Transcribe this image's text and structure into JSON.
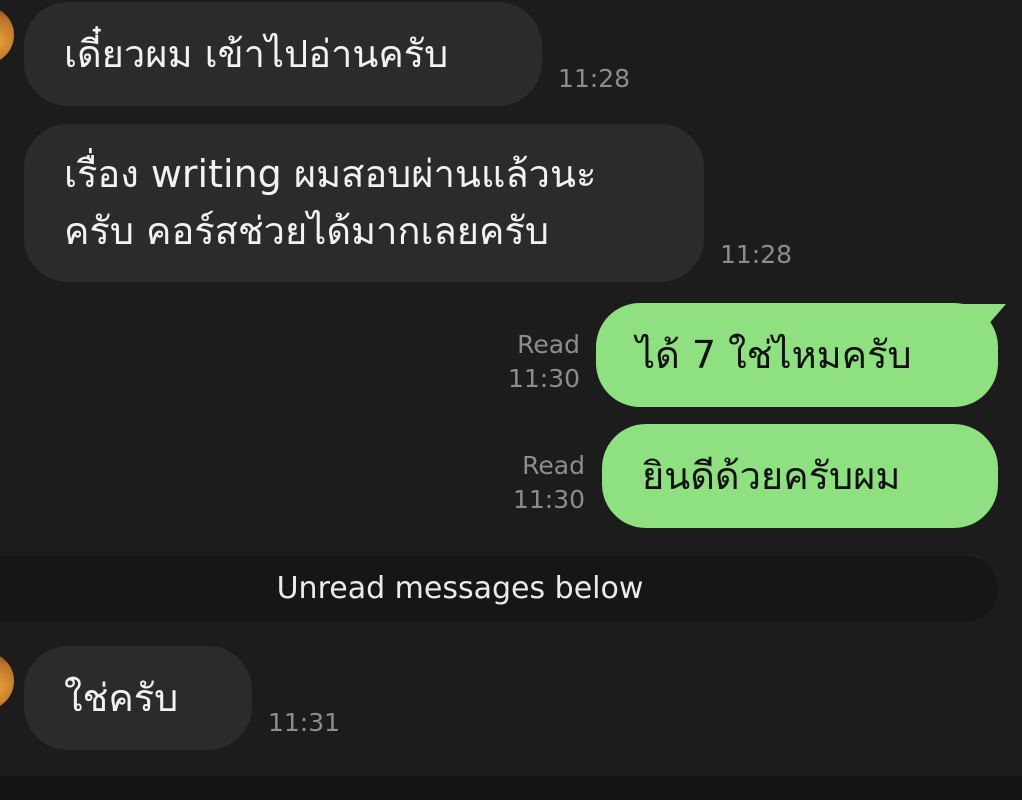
{
  "messages": [
    {
      "direction": "in",
      "text": "เดี๋ยวผม เข้าไปอ่านครับ",
      "time": "11:28"
    },
    {
      "direction": "in",
      "lines": [
        "เรื่อง writing ผมสอบผ่านแล้วนะ",
        "ครับ คอร์สช่วยได้มากเลยครับ"
      ],
      "time": "11:28"
    },
    {
      "direction": "out",
      "text": "ได้ 7 ใช่ไหมครับ",
      "status": "Read",
      "time": "11:30"
    },
    {
      "direction": "out",
      "text": "ยินดีด้วยครับผม",
      "status": "Read",
      "time": "11:30"
    },
    {
      "direction": "in",
      "text": "ใช่ครับ",
      "time": "11:31"
    }
  ],
  "divider": {
    "label": "Unread messages below"
  },
  "colors": {
    "background": "#1c1c1c",
    "incoming_bubble": "#2b2b2b",
    "outgoing_bubble": "#8ee080",
    "meta_text": "#8d8d8d"
  }
}
